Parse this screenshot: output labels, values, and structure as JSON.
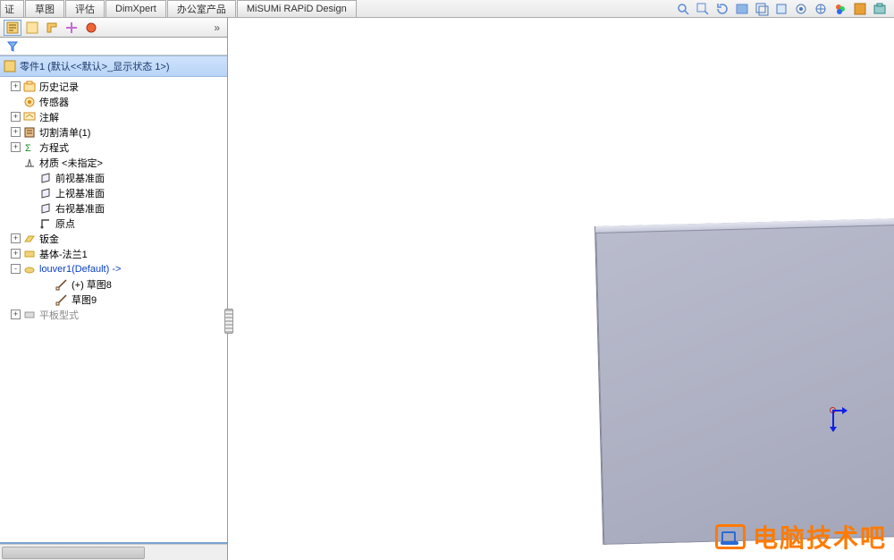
{
  "tabs": {
    "items": [
      {
        "label": "证"
      },
      {
        "label": "草图"
      },
      {
        "label": "评估"
      },
      {
        "label": "DimXpert"
      },
      {
        "label": "办公室产品"
      },
      {
        "label": "MiSUMi RAPiD Design"
      }
    ]
  },
  "view_toolbar": {
    "icons": [
      "zoom-fit-icon",
      "zoom-area-icon",
      "rotate-view-icon",
      "section-icon",
      "display-style-icon",
      "hide-show-icon",
      "scene-icon",
      "view-settings-icon",
      "appearance-icon",
      "render-icon",
      "screen-capture-icon"
    ]
  },
  "panel_tabs": {
    "items": [
      {
        "name": "feature-manager-tab",
        "active": true
      },
      {
        "name": "property-manager-tab",
        "active": false
      },
      {
        "name": "configuration-manager-tab",
        "active": false
      },
      {
        "name": "dimxpert-manager-tab",
        "active": false
      },
      {
        "name": "display-manager-tab",
        "active": false
      }
    ],
    "chevron": "»"
  },
  "tree_header": {
    "label": "零件1  (默认<<默认>_显示状态 1>)"
  },
  "tree": {
    "items": [
      {
        "lvl": 1,
        "exp": "+",
        "icon": "history-icon",
        "iconColor": "#d58b1e",
        "label": "历史记录"
      },
      {
        "lvl": 1,
        "exp": "",
        "icon": "sensor-icon",
        "iconColor": "#d58b1e",
        "label": "传感器"
      },
      {
        "lvl": 1,
        "exp": "+",
        "icon": "annotation-icon",
        "iconColor": "#d58b1e",
        "label": "注解"
      },
      {
        "lvl": 1,
        "exp": "+",
        "icon": "cutlist-icon",
        "iconColor": "#6b3f1a",
        "label": "切割清单(1)"
      },
      {
        "lvl": 1,
        "exp": "+",
        "icon": "equation-icon",
        "iconColor": "#1e8a1e",
        "label": "方程式"
      },
      {
        "lvl": 1,
        "exp": "",
        "icon": "material-icon",
        "iconColor": "#666",
        "label": "材质 <未指定>"
      },
      {
        "lvl": 2,
        "exp": "",
        "icon": "plane-icon",
        "iconColor": "#444",
        "label": "前视基准面"
      },
      {
        "lvl": 2,
        "exp": "",
        "icon": "plane-icon",
        "iconColor": "#444",
        "label": "上视基准面"
      },
      {
        "lvl": 2,
        "exp": "",
        "icon": "plane-icon",
        "iconColor": "#444",
        "label": "右视基准面"
      },
      {
        "lvl": 2,
        "exp": "",
        "icon": "origin-icon",
        "iconColor": "#444",
        "label": "原点"
      },
      {
        "lvl": 1,
        "exp": "+",
        "icon": "sheetmetal-icon",
        "iconColor": "#c9a227",
        "label": "钣金"
      },
      {
        "lvl": 1,
        "exp": "+",
        "icon": "baseflange-icon",
        "iconColor": "#c9a227",
        "label": "基体-法兰1"
      },
      {
        "lvl": 1,
        "exp": "-",
        "icon": "louver-icon",
        "iconColor": "#c9a227",
        "label": "louver1(Default) ->",
        "style": "blue"
      },
      {
        "lvl": 3,
        "exp": "",
        "icon": "sketch-icon",
        "iconColor": "#6b3f1a",
        "label": "(+) 草图8"
      },
      {
        "lvl": 3,
        "exp": "",
        "icon": "sketch-icon",
        "iconColor": "#6b3f1a",
        "label": "草图9"
      },
      {
        "lvl": 1,
        "exp": "+",
        "icon": "flatpattern-icon",
        "iconColor": "#999",
        "label": "平板型式",
        "style": "grey"
      }
    ]
  },
  "watermark": {
    "text": "电脑技术吧"
  }
}
